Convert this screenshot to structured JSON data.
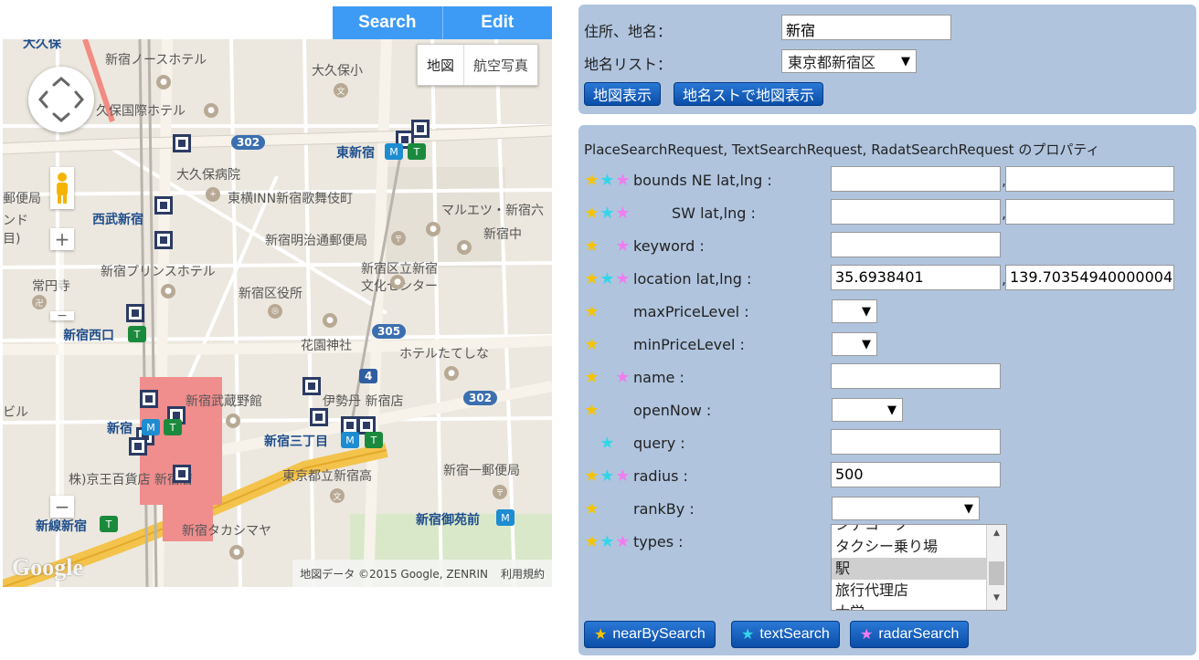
{
  "tabs": {
    "search": "Search",
    "edit": "Edit"
  },
  "map": {
    "maptype_map": "地図",
    "maptype_satellite": "航空写真",
    "attribution": "地図データ ©2015 Google, ZENRIN",
    "terms": "利用規約",
    "logo": "Google",
    "labels": {
      "okubo": "大久保",
      "north_hotel": "新宿ノースホテル",
      "okubo_elem": "大久保小",
      "okubo_kokusai": "久保国際ホテル",
      "route302a": "302",
      "higashi_shinjuku": "東新宿",
      "okubo_hospital": "大久保病院",
      "toyoko_inn": "東横INN新宿歌舞伎町",
      "post": "郵便局",
      "nd": "ンド",
      "me": "目)",
      "seibu_shinjuku": "西武新宿",
      "maruetsu": "マルエツ・新宿六",
      "shinjuku_naka": "新宿中",
      "meiji_post": "新宿明治通郵便局",
      "prince_hotel": "新宿プリンスホテル",
      "bunka_center": "新宿区立新宿",
      "bunka_center2": "文化センター",
      "joenji": "常円寺",
      "ward_office": "新宿区役所",
      "route305": "305",
      "shinjuku_nishiguchi": "新宿西口",
      "hanazono": "花園神社",
      "hotel_tateshina": "ホテルたてしな",
      "route4": "4",
      "musashino": "新宿武蔵野館",
      "isetan": "伊勢丹 新宿店",
      "route302b": "302",
      "biru": "ビル",
      "shinjuku": "新宿",
      "sanchome": "新宿三丁目",
      "keio": "株)京王百貨店 新宿店",
      "toritsu_high": "東京都立新宿高",
      "ichiban_post": "新宿一郵便局",
      "shinsen_shinjuku": "新線新宿",
      "gyoen": "新宿御苑前",
      "takashimaya": "新宿タカシマヤ"
    }
  },
  "panel1": {
    "address_label": "住所、地名：",
    "address_value": "新宿",
    "list_label": "地名リスト：",
    "list_value": "東京都新宿区",
    "btn_show": "地図表示",
    "btn_list_show": "地名ストで地図表示"
  },
  "panel2": {
    "title": "PlaceSearchRequest, TextSearchRequest, RadatSearchRequest のプロパティ",
    "rows": [
      {
        "label": "bounds NE lat,lng :",
        "stars": [
          true,
          true,
          true
        ],
        "v1": "",
        "v2": ""
      },
      {
        "label": "SW lat,lng :",
        "stars": [
          true,
          true,
          true
        ],
        "v1": "",
        "v2": ""
      },
      {
        "label": "keyword :",
        "stars": [
          true,
          false,
          true
        ],
        "v1": ""
      },
      {
        "label": "location lat,lng :",
        "stars": [
          true,
          true,
          true
        ],
        "v1": "35.6938401",
        "v2": "139.70354940000004"
      },
      {
        "label": "maxPriceLevel :",
        "stars": [
          true,
          false,
          false
        ],
        "v1": ""
      },
      {
        "label": "minPriceLevel :",
        "stars": [
          true,
          false,
          false
        ],
        "v1": ""
      },
      {
        "label": "name :",
        "stars": [
          true,
          false,
          true
        ],
        "v1": ""
      },
      {
        "label": "openNow :",
        "stars": [
          true,
          false,
          false
        ],
        "v1": ""
      },
      {
        "label": "query :",
        "stars": [
          false,
          true,
          false
        ],
        "v1": ""
      },
      {
        "label": "radius :",
        "stars": [
          true,
          true,
          true
        ],
        "v1": "500"
      },
      {
        "label": "rankBy :",
        "stars": [
          true,
          false,
          false
        ],
        "v1": ""
      },
      {
        "label": "types :",
        "stars": [
          true,
          true,
          true
        ]
      }
    ],
    "types_options": [
      "シデコーク",
      "タクシー乗り場",
      "駅",
      "旅行代理店",
      "大学"
    ],
    "types_selected": "駅",
    "btn_nearby": "nearBySearch",
    "btn_text": "textSearch",
    "btn_radar": "radarSearch",
    "star_glyph": "★",
    "colors": {
      "star1": "#f5c400",
      "star2": "#33d6e8",
      "star3": "#f07cf0",
      "panel": "#b0c4de",
      "tab": "#3d9bf5"
    }
  }
}
